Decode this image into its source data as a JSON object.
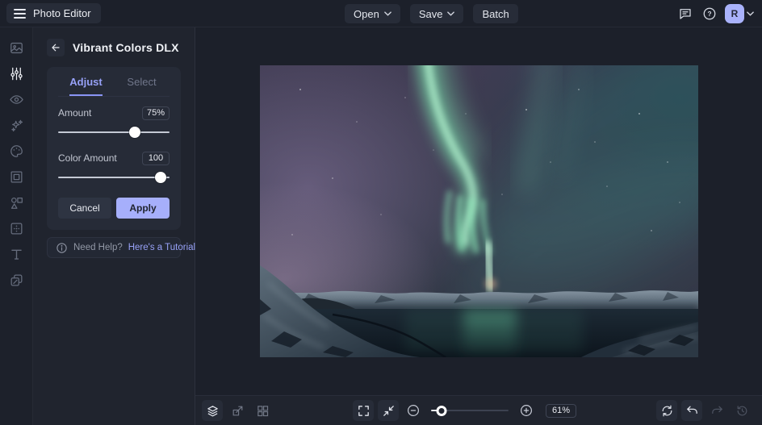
{
  "topbar": {
    "app_title": "Photo Editor",
    "open_label": "Open",
    "save_label": "Save",
    "batch_label": "Batch",
    "avatar_initial": "R"
  },
  "sidebar": {
    "tools": [
      "image",
      "adjustments",
      "eye",
      "effects",
      "palette",
      "frame",
      "shapes",
      "retouch",
      "text",
      "duplicate"
    ],
    "active_tool": "adjustments"
  },
  "panel": {
    "title": "Vibrant Colors DLX",
    "tabs": [
      {
        "label": "Adjust"
      },
      {
        "label": "Select"
      }
    ],
    "controls": [
      {
        "label": "Amount",
        "value": "75%",
        "percent": 69
      },
      {
        "label": "Color Amount",
        "value": "100",
        "percent": 92
      }
    ],
    "cancel_label": "Cancel",
    "apply_label": "Apply",
    "help": {
      "prefix": "Need Help?",
      "link_label": "Here's a Tutorial"
    }
  },
  "statusbar": {
    "zoom_value": "61%",
    "zoom_percent": 14
  },
  "icons": {
    "help_glyph": "?"
  },
  "colors": {
    "accent": "#97a1f7",
    "avatar_bg": "#a9b2fb",
    "apply_bg": "#a6affb",
    "canvas_bg": "#1c202a"
  }
}
